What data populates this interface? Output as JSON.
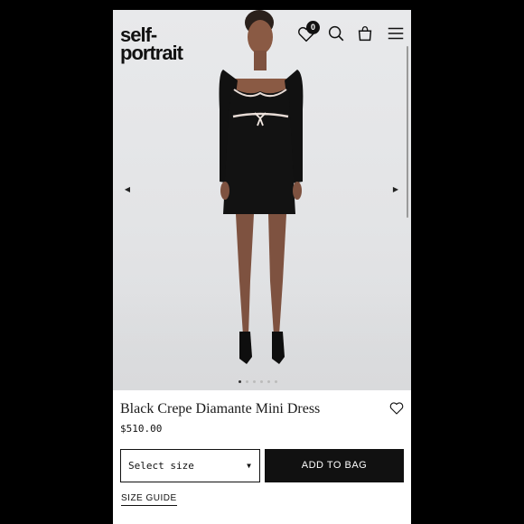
{
  "brand": {
    "logo_line1": "self-",
    "logo_line2": "portrait"
  },
  "header": {
    "wishlist_count": "0",
    "icons": [
      "heart-icon",
      "search-icon",
      "bag-icon",
      "menu-icon"
    ]
  },
  "gallery": {
    "slide_count": 6,
    "active_slide": 1
  },
  "product": {
    "name": "Black Crepe Diamante Mini Dress",
    "price": "$510.00"
  },
  "actions": {
    "size_select_label": "Select size",
    "add_to_bag_label": "ADD TO BAG",
    "size_guide_label": "SIZE GUIDE"
  },
  "colors": {
    "accent": "#111111",
    "background": "#ffffff",
    "hero_bg": "#e3e4e6"
  }
}
